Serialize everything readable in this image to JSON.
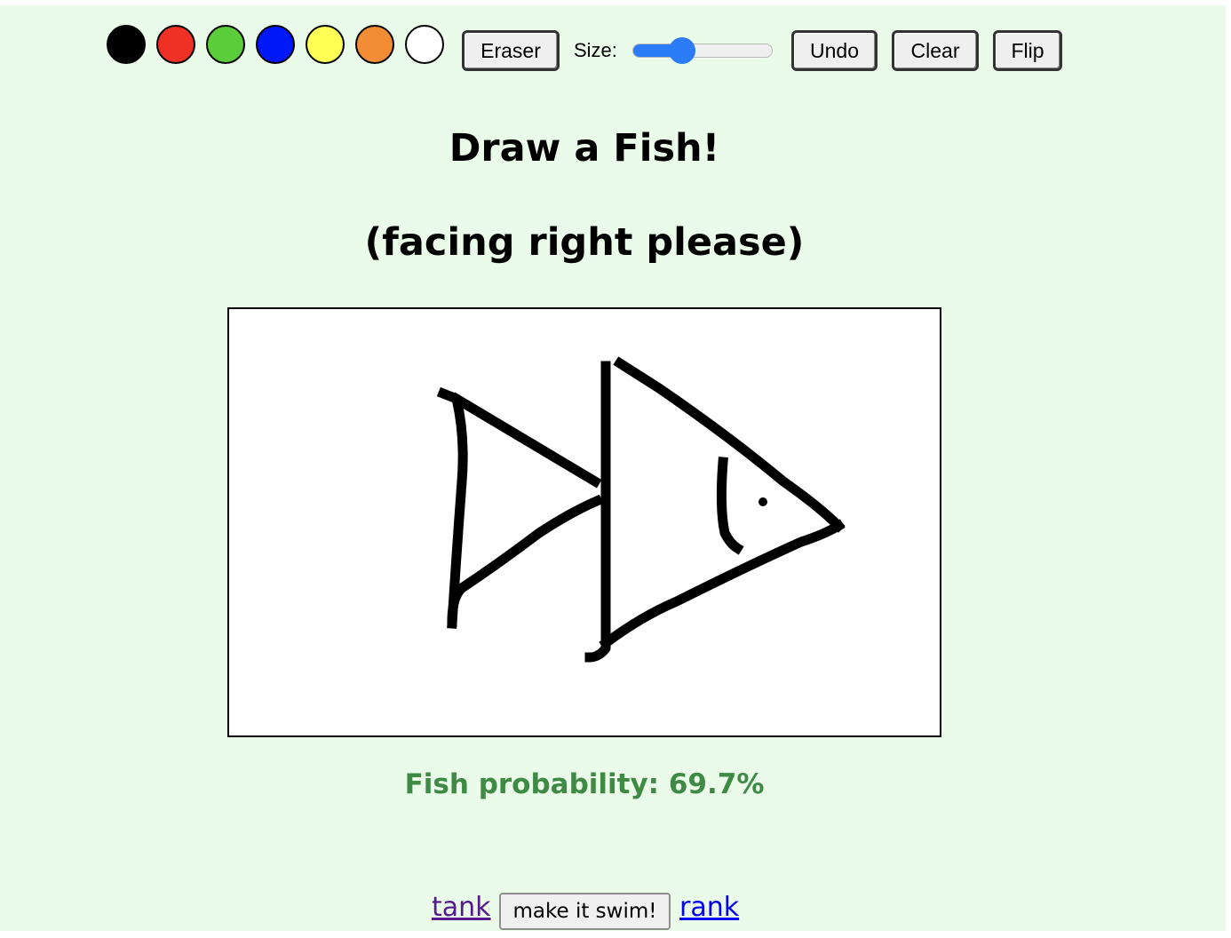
{
  "toolbar": {
    "colors": [
      {
        "name": "black",
        "hex": "#000000"
      },
      {
        "name": "red",
        "hex": "#ee3124"
      },
      {
        "name": "green",
        "hex": "#5bcc3a"
      },
      {
        "name": "blue",
        "hex": "#0018f8"
      },
      {
        "name": "yellow",
        "hex": "#ffff55"
      },
      {
        "name": "orange",
        "hex": "#f28d36"
      },
      {
        "name": "white",
        "hex": "#ffffff"
      }
    ],
    "eraser_label": "Eraser",
    "size_label": "Size:",
    "size_value": 0.32,
    "undo_label": "Undo",
    "clear_label": "Clear",
    "flip_label": "Flip"
  },
  "main": {
    "title": "Draw a Fish!",
    "subtitle": "(facing right please)",
    "probability_text": "Fish probability: 69.7%",
    "probability_color": "#3f8a45"
  },
  "footer": {
    "tank_label": "tank",
    "swim_label": "make it swim!",
    "rank_label": "rank",
    "visited_link_color": "#551a8b",
    "link_color": "#0000ee"
  }
}
